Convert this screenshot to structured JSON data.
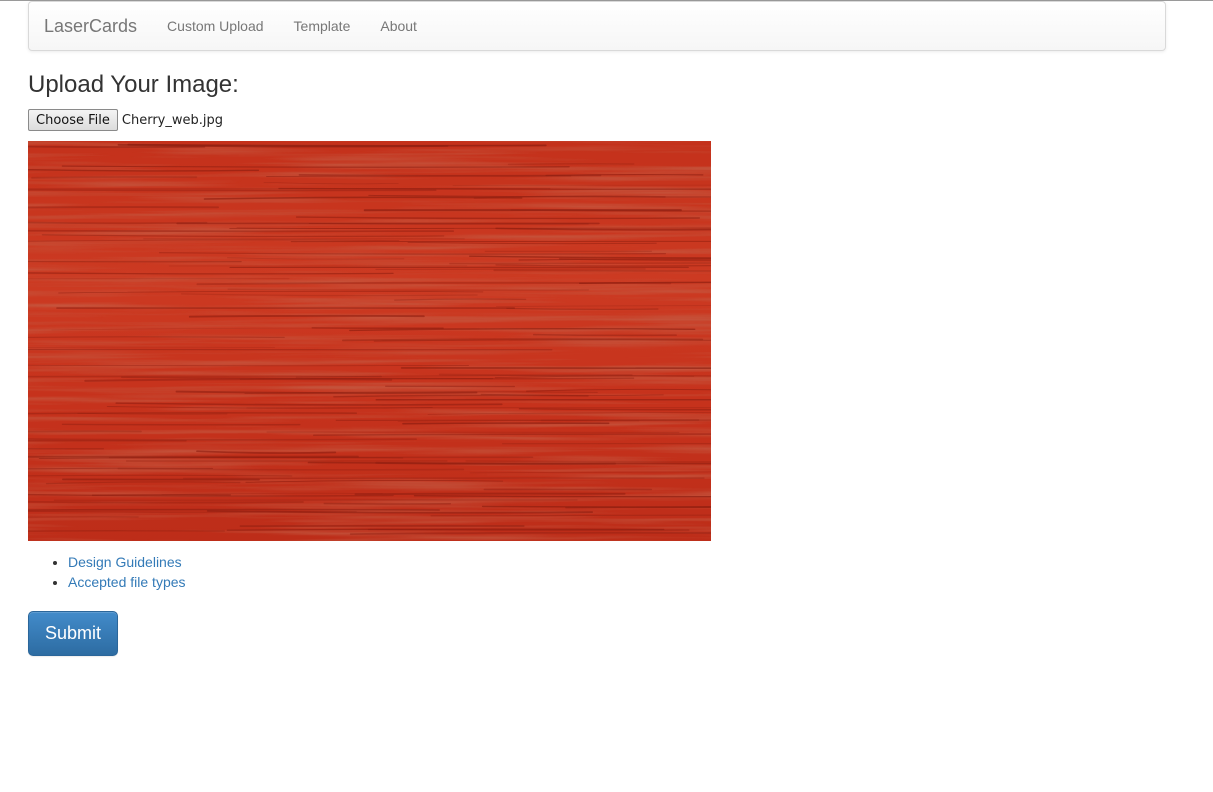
{
  "navbar": {
    "brand": "LaserCards",
    "items": [
      {
        "label": "Custom Upload"
      },
      {
        "label": "Template"
      },
      {
        "label": "About"
      }
    ]
  },
  "upload": {
    "heading": "Upload Your Image:",
    "choose_button_label": "Choose File",
    "selected_file": "Cherry_web.jpg",
    "preview_description": "cherry wood grain texture"
  },
  "links": [
    {
      "label": "Design Guidelines"
    },
    {
      "label": "Accepted file types"
    }
  ],
  "submit_label": "Submit",
  "colors": {
    "link": "#337ab7",
    "primary_button": "#337ab7",
    "wood_base": "#c8321c",
    "wood_dark": "#8e1e10"
  }
}
